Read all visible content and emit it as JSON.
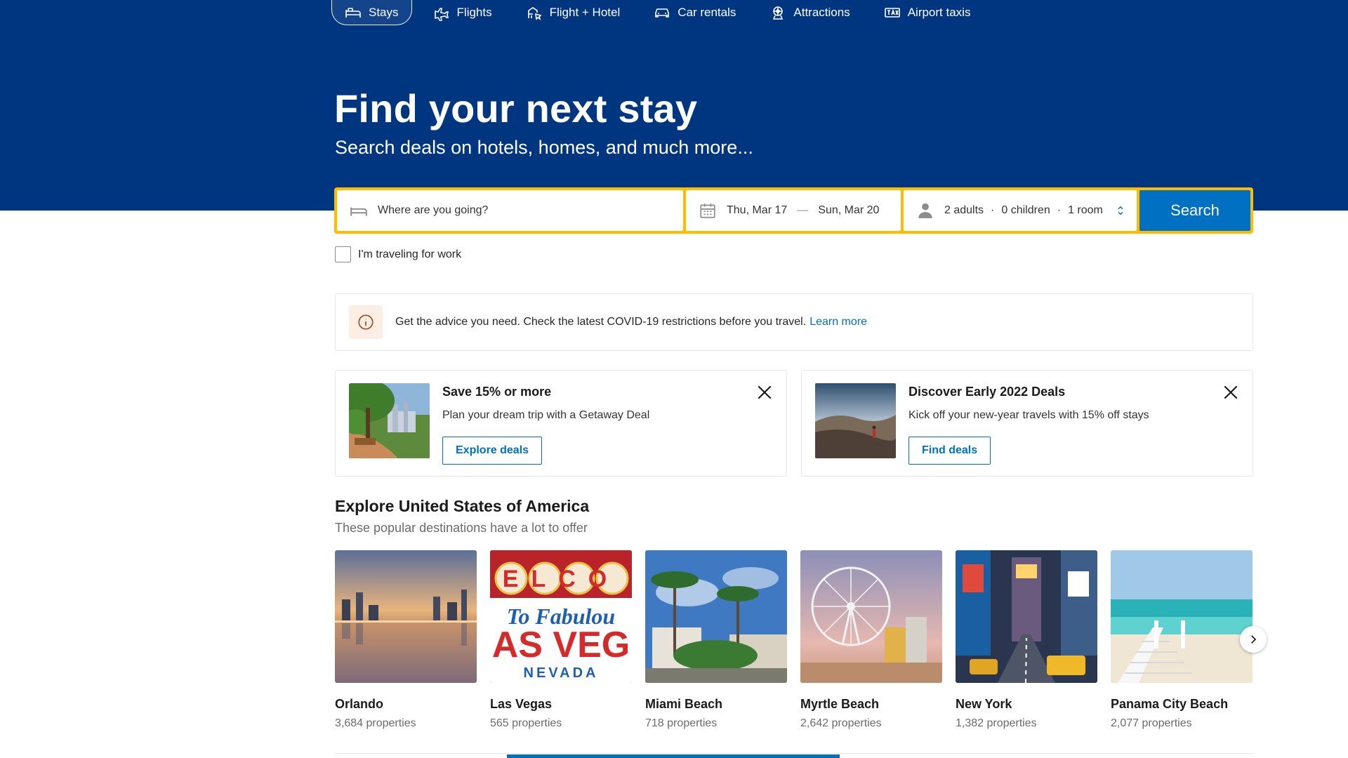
{
  "colors": {
    "brand_blue": "#003580",
    "accent_yellow": "#febb02",
    "action_blue": "#0071c2"
  },
  "nav": {
    "items": [
      {
        "label": "Stays",
        "icon": "bed-icon",
        "active": true
      },
      {
        "label": "Flights",
        "icon": "plane-icon"
      },
      {
        "label": "Flight + Hotel",
        "icon": "flight-hotel-icon"
      },
      {
        "label": "Car rentals",
        "icon": "car-icon"
      },
      {
        "label": "Attractions",
        "icon": "attractions-icon"
      },
      {
        "label": "Airport taxis",
        "icon": "taxi-icon"
      }
    ]
  },
  "hero": {
    "title": "Find your next stay",
    "subtitle": "Search deals on hotels, homes, and much more..."
  },
  "search": {
    "destination_placeholder": "Where are you going?",
    "checkin": "Thu, Mar 17",
    "date_separator": "—",
    "checkout": "Sun, Mar 20",
    "adults": "2 adults",
    "children": "0 children",
    "rooms": "1 room",
    "separator": "·",
    "button_label": "Search",
    "work_travel_label": "I'm traveling for work"
  },
  "notice": {
    "text": "Get the advice you need. Check the latest COVID-19 restrictions before you travel.",
    "link_label": "Learn more"
  },
  "promos": [
    {
      "title": "Save 15% or more",
      "text": "Plan your dream trip with a Getaway Deal",
      "button": "Explore deals"
    },
    {
      "title": "Discover Early 2022 Deals",
      "text": "Kick off your new-year travels with 15% off stays",
      "button": "Find deals"
    }
  ],
  "explore": {
    "title": "Explore United States of America",
    "subtitle": "These popular destinations have a lot to offer",
    "destinations": [
      {
        "name": "Orlando",
        "count": "3,684 properties"
      },
      {
        "name": "Las Vegas",
        "count": "565 properties"
      },
      {
        "name": "Miami Beach",
        "count": "718 properties"
      },
      {
        "name": "Myrtle Beach",
        "count": "2,642 properties"
      },
      {
        "name": "New York",
        "count": "1,382 properties"
      },
      {
        "name": "Panama City Beach",
        "count": "2,077 properties"
      }
    ],
    "vegas_sign": {
      "line1": "ELCO",
      "line2": "To Fabulou",
      "line3": "AS VEG",
      "line4": "NEVADA"
    }
  }
}
